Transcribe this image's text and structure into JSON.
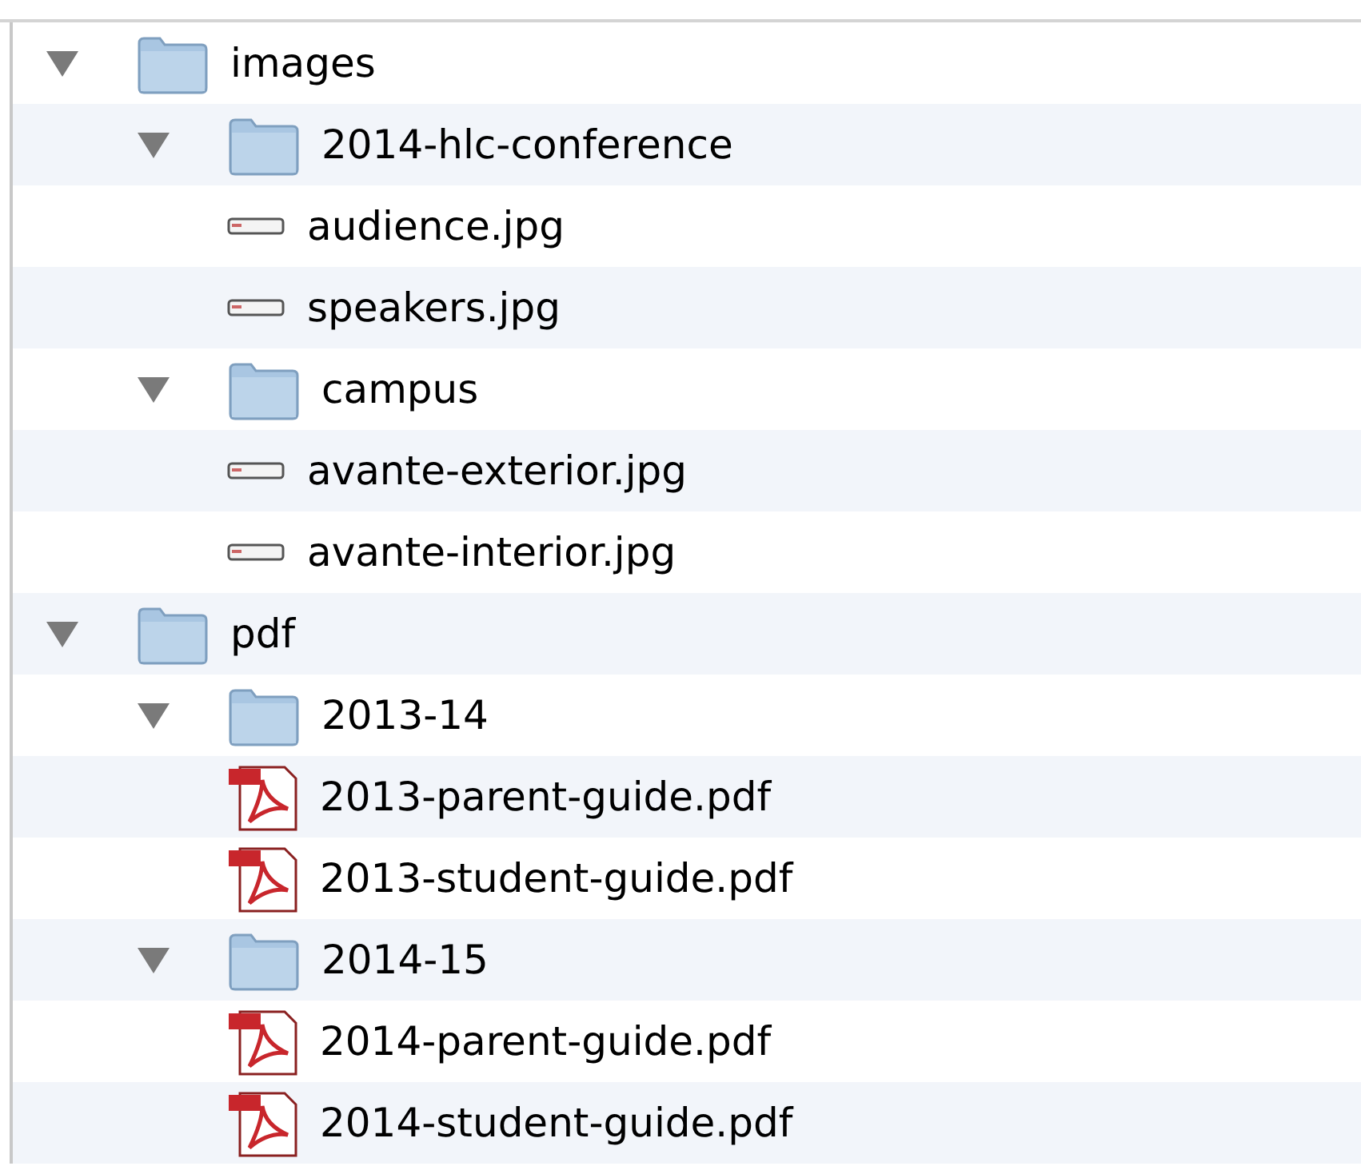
{
  "tree": [
    {
      "kind": "folder",
      "name": "images",
      "expanded": true,
      "children": [
        {
          "kind": "folder",
          "name": "2014-hlc-conference",
          "expanded": true,
          "children": [
            {
              "kind": "image",
              "name": "audience.jpg"
            },
            {
              "kind": "image",
              "name": "speakers.jpg"
            }
          ]
        },
        {
          "kind": "folder",
          "name": "campus",
          "expanded": true,
          "children": [
            {
              "kind": "image",
              "name": "avante-exterior.jpg"
            },
            {
              "kind": "image",
              "name": "avante-interior.jpg"
            }
          ]
        }
      ]
    },
    {
      "kind": "folder",
      "name": "pdf",
      "expanded": true,
      "children": [
        {
          "kind": "folder",
          "name": "2013-14",
          "expanded": true,
          "children": [
            {
              "kind": "pdf",
              "name": "2013-parent-guide.pdf"
            },
            {
              "kind": "pdf",
              "name": "2013-student-guide.pdf"
            }
          ]
        },
        {
          "kind": "folder",
          "name": "2014-15",
          "expanded": true,
          "children": [
            {
              "kind": "pdf",
              "name": "2014-parent-guide.pdf"
            },
            {
              "kind": "pdf",
              "name": "2014-student-guide.pdf"
            }
          ]
        }
      ]
    }
  ]
}
